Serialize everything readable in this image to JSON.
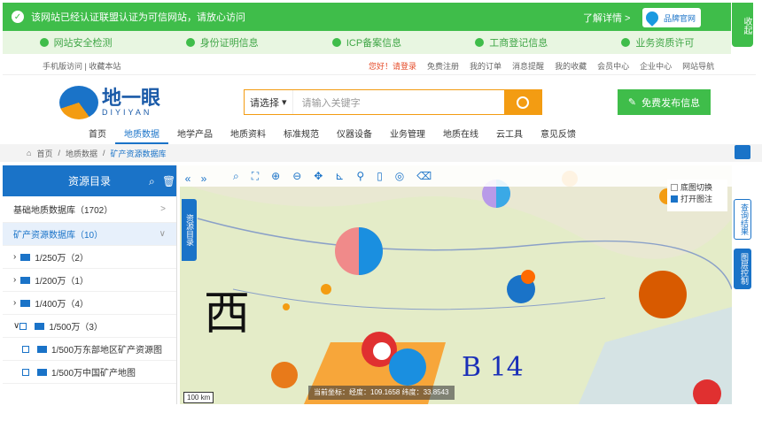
{
  "cert_bar": {
    "text": "该网站已经认证联盟认证为可信网站，请放心访问",
    "more": "了解详情 >",
    "badge": "品牌官网"
  },
  "side_collapse": "收起",
  "checks": [
    "网站安全检测",
    "身份证明信息",
    "ICP备案信息",
    "工商登记信息",
    "业务资质许可"
  ],
  "topline": {
    "left": "手机版访问 | 收藏本站",
    "links": [
      "您好！请登录",
      "免费注册",
      "我的订单",
      "消息提醒",
      "我的收藏",
      "会员中心",
      "企业中心",
      "网站导航"
    ]
  },
  "logo": {
    "name": "地一眼",
    "sub": "DIYIYAN"
  },
  "search": {
    "select": "请选择",
    "placeholder": "请输入关键字"
  },
  "post_button": "免费发布信息",
  "nav": [
    "首页",
    "地质数据",
    "地学产品",
    "地质资料",
    "标准规范",
    "仪器设备",
    "业务管理",
    "地质在线",
    "云工具",
    "意见反馈"
  ],
  "crumb": [
    "首页",
    "地质数据",
    "矿产资源数据库"
  ],
  "sidebar": {
    "title": "资源目录",
    "rows": [
      {
        "label": "基础地质数据库（1702）",
        "arrow": ">"
      },
      {
        "label": "矿产资源数据库（10）",
        "arrow": "∨"
      },
      {
        "label": "1/250万（2）"
      },
      {
        "label": "1/200万（1）"
      },
      {
        "label": "1/400万（4）"
      },
      {
        "label": "1/500万（3）"
      },
      {
        "label": "1/500万东部地区矿产资源图"
      },
      {
        "label": "1/500万中国矿产地图"
      }
    ]
  },
  "map": {
    "dir_tab": "资源目录",
    "legend": [
      "底图切换",
      "打开图注"
    ],
    "big_labels": [
      "西",
      "B 14"
    ],
    "coord": "当前坐标：经度：109.1658  纬度：33.8543",
    "scale": "100 km"
  },
  "right_tabs": [
    "查询结果",
    "图层控制"
  ]
}
